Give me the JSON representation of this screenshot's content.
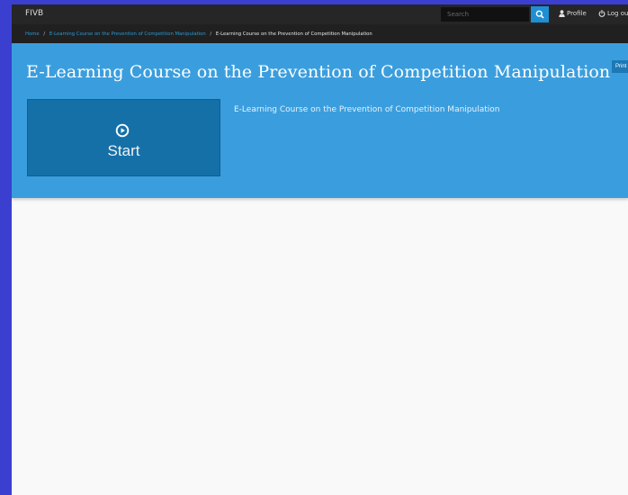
{
  "topbar": {
    "brand": "FIVB",
    "search_placeholder": "Search",
    "profile_label": "Profile",
    "logout_label": "Log out"
  },
  "breadcrumb": {
    "home": "Home",
    "separator": "/",
    "parent": "E-Learning Course on the Prevention of Competition Manipulation",
    "current": "E-Learning Course on the Prevention of Competition Manipulation"
  },
  "course": {
    "title": "E-Learning Course on the Prevention of Competition Manipulation",
    "description": "E-Learning Course on the Prevention of Competition Manipulation",
    "start_label": "Start",
    "print_label": "Print"
  },
  "icons": {
    "search": "search-icon",
    "profile": "user-icon",
    "logout": "power-icon",
    "start": "play-circle-icon"
  },
  "colors": {
    "outer_background": "#3a3fd0",
    "topbar": "#262626",
    "hero": "#3a9ede",
    "start_button": "#1570a8",
    "link": "#2a9bd9",
    "accent_button": "#1f8fd3"
  }
}
